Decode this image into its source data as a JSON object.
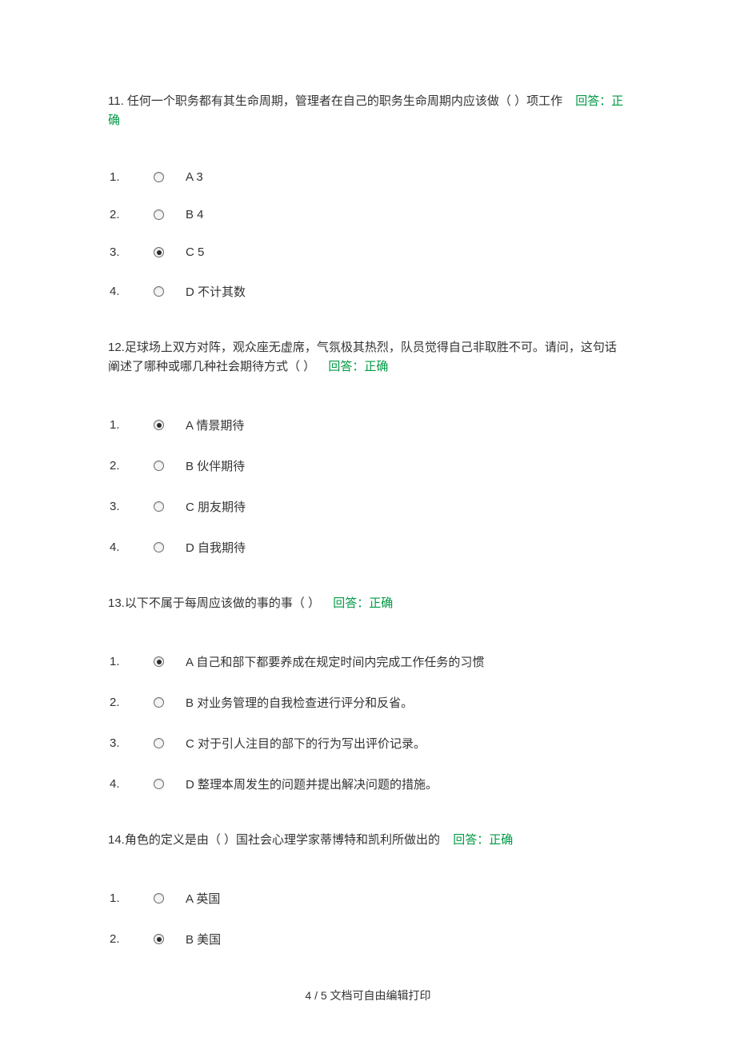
{
  "q11": {
    "text": "11.  任何一个职务都有其生命周期，管理者在自己的职务生命周期内应该做（ ）项工作",
    "answer_label": "回答：",
    "answer_value": "正确",
    "options": [
      {
        "num": "1.",
        "text": "A  3",
        "selected": false
      },
      {
        "num": "2.",
        "text": "B  4",
        "selected": false
      },
      {
        "num": "3.",
        "text": "C  5",
        "selected": true
      },
      {
        "num": "4.",
        "text": "D  不计其数",
        "selected": false
      }
    ]
  },
  "q12": {
    "text": "12.足球场上双方对阵，观众座无虚席，气氛极其热烈，队员觉得自己非取胜不可。请问，这句话阐述了哪种或哪几种社会期待方式（ ）",
    "answer_label": "回答：",
    "answer_value": "正确",
    "options": [
      {
        "num": "1.",
        "text": "A 情景期待",
        "selected": true
      },
      {
        "num": "2.",
        "text": "B 伙伴期待",
        "selected": false
      },
      {
        "num": "3.",
        "text": "C 朋友期待",
        "selected": false
      },
      {
        "num": "4.",
        "text": "D 自我期待",
        "selected": false
      }
    ]
  },
  "q13": {
    "text": "13.以下不属于每周应该做的事的事（ ）",
    "answer_label": "回答：",
    "answer_value": "正确",
    "options": [
      {
        "num": "1.",
        "text": "A 自己和部下都要养成在规定时间内完成工作任务的习惯",
        "selected": true
      },
      {
        "num": "2.",
        "text": "B 对业务管理的自我检查进行评分和反省。",
        "selected": false
      },
      {
        "num": "3.",
        "text": "C 对于引人注目的部下的行为写出评价记录。",
        "selected": false
      },
      {
        "num": "4.",
        "text": "D 整理本周发生的问题并提出解决问题的措施。",
        "selected": false
      }
    ]
  },
  "q14": {
    "text": "14.角色的定义是由（ ）国社会心理学家蒂博特和凯利所做出的",
    "answer_label": "回答：",
    "answer_value": "正确",
    "options": [
      {
        "num": "1.",
        "text": "A 英国",
        "selected": false
      },
      {
        "num": "2.",
        "text": "B 美国",
        "selected": true
      }
    ]
  },
  "footer": "4 / 5 文档可自由编辑打印"
}
